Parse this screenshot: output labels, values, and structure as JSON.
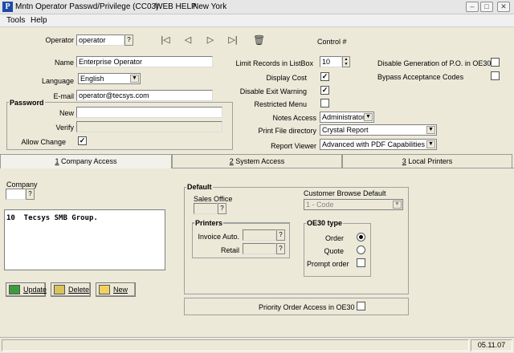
{
  "window": {
    "title": "Mntn Operator Passwd/Privilege (CC03)",
    "help": "WEB HELP",
    "location": "New York",
    "app_letter": "P"
  },
  "menu": {
    "items": [
      "Tools",
      "Help"
    ]
  },
  "operator": {
    "label": "Operator",
    "value": "operator",
    "q": "?"
  },
  "control": {
    "label": "Control #"
  },
  "identity": {
    "name_label": "Name",
    "name_value": "Enterprise Operator",
    "language_label": "Language",
    "language_value": "English",
    "email_label": "E-mail",
    "email_value": "operator@tecsys.com"
  },
  "password": {
    "title": "Password",
    "new_label": "New",
    "verify_label": "Verify",
    "allow_change_label": "Allow Change",
    "allow_change_checked": "✓"
  },
  "options": {
    "limit_label": "Limit Records in ListBox",
    "limit_value": "10",
    "display_cost_label": "Display Cost",
    "display_cost_checked": "✓",
    "disable_exit_label": "Disable Exit Warning",
    "disable_exit_checked": "✓",
    "restricted_label": "Restricted Menu",
    "notes_label": "Notes Access",
    "notes_value": "Administrator",
    "print_label": "Print File directory",
    "print_value": "Crystal Report",
    "viewer_label": "Report Viewer",
    "viewer_value": "Advanced with PDF Capabilities",
    "disable_po_label": "Disable Generation of P.O. in OE30",
    "bypass_label": "Bypass Acceptance Codes"
  },
  "tabs": [
    {
      "num": "1",
      "label": " Company Access"
    },
    {
      "num": "2",
      "label": " System Access"
    },
    {
      "num": "3",
      "label": " Local Printers"
    }
  ],
  "company": {
    "label": "Company",
    "q": "?",
    "list": [
      "10  Tecsys SMB Group."
    ]
  },
  "buttons": {
    "update": "Update",
    "delete": "Delete",
    "new": "New"
  },
  "default": {
    "title": "Default",
    "sales_office_label": "Sales Office",
    "q": "?",
    "customer_browse_label": "Customer Browse Default",
    "customer_browse_value": "1 - Code",
    "printers_title": "Printers",
    "invoice_label": "Invoice Auto.",
    "retail_label": "Retail",
    "oe30_title": "OE30 type",
    "order_label": "Order",
    "quote_label": "Quote",
    "prompt_label": "Prompt order",
    "selected_type": "order"
  },
  "priority": {
    "label": "Priority Order Access in OE30"
  },
  "status": {
    "date": "05.11.07"
  },
  "colors": {
    "bg": "#ece9d8",
    "accent": "#1f4aa8"
  }
}
